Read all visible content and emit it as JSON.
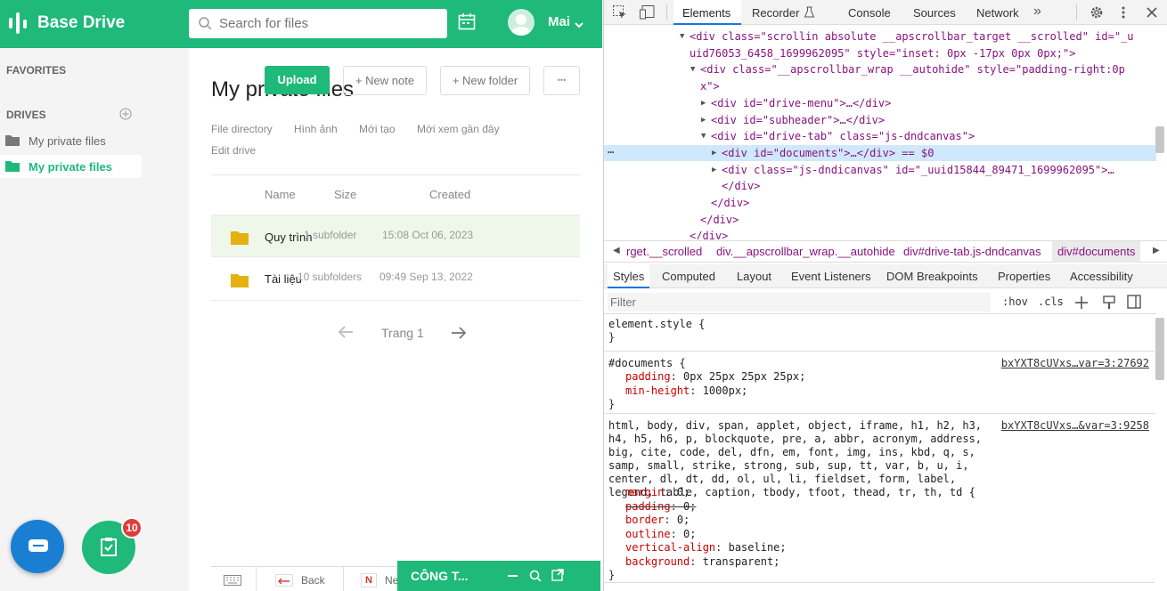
{
  "app": {
    "brand": "Base Drive",
    "search_placeholder": "Search for files",
    "user": "Mai",
    "sidebar": {
      "favorites": "FAVORITES",
      "drives": "DRIVES",
      "items": [
        {
          "label": "My private files"
        },
        {
          "label": "My private files"
        }
      ]
    },
    "main": {
      "title": "My private files",
      "upload": "Upload",
      "new_note": "+ New note",
      "new_folder": "+ New folder",
      "more": "•••",
      "tabs": [
        "File directory",
        "Hình ảnh",
        "Mới tạo",
        "Mới xem gần đây",
        "Edit drive"
      ],
      "columns": {
        "name": "Name",
        "size": "Size",
        "created": "Created"
      },
      "rows": [
        {
          "name": "Quy trình",
          "size": "1 subfolder",
          "created": "15:08 Oct 06, 2023"
        },
        {
          "name": "Tài liệu",
          "size": "10 subfolders",
          "created": "09:49 Sep 13, 2022"
        }
      ],
      "page": "Trang 1"
    },
    "badge": "10",
    "bottom": {
      "back": "Back",
      "next": "Ne",
      "company": "CÔNG T..."
    }
  },
  "devtools": {
    "tabs": [
      "Elements",
      "Recorder",
      "Console",
      "Sources",
      "Network"
    ],
    "tree": [
      {
        "indent": 0,
        "arrow": "▼",
        "html": "<div class=\"scrollin absolute __apscrollbar_target __scrolled\" id=\"_u"
      },
      {
        "indent": 0,
        "arrow": "",
        "html": "uid76053_6458_1699962095\" style=\"inset: 0px -17px 0px 0px;\">"
      },
      {
        "indent": 1,
        "arrow": "▼",
        "html": "<div class=\"__apscrollbar_wrap __autohide\" style=\"padding-right:0p"
      },
      {
        "indent": 1,
        "arrow": "",
        "html": "x\">"
      },
      {
        "indent": 2,
        "arrow": "▶",
        "html": "<div id=\"drive-menu\">…</div>"
      },
      {
        "indent": 2,
        "arrow": "▶",
        "html": "<div id=\"subheader\">…</div>"
      },
      {
        "indent": 2,
        "arrow": "▼",
        "html": "<div id=\"drive-tab\" class=\"js-dndcanvas\">"
      },
      {
        "indent": 3,
        "arrow": "▶",
        "html": "<div id=\"documents\">…</div> == $0"
      },
      {
        "indent": 3,
        "arrow": "▶",
        "html": "<div class=\"js-dndicanvas\" id=\"_uuid15844_89471_1699962095\">…"
      },
      {
        "indent": 3,
        "arrow": "",
        "html": "</div>"
      },
      {
        "indent": 2,
        "arrow": "",
        "html": "</div>"
      },
      {
        "indent": 1,
        "arrow": "",
        "html": "</div>"
      },
      {
        "indent": 0,
        "arrow": "",
        "html": "</div>"
      }
    ],
    "breadcrumbs": [
      "rget.__scrolled",
      "div.__apscrollbar_wrap.__autohide",
      "div#drive-tab.js-dndcanvas",
      "div#documents"
    ],
    "subtabs": [
      "Styles",
      "Computed",
      "Layout",
      "Event Listeners",
      "DOM Breakpoints",
      "Properties",
      "Accessibility"
    ],
    "filter": "Filter",
    "hov": ":hov",
    "cls": ".cls",
    "rules": [
      {
        "selector": "element.style {",
        "source": "",
        "props": []
      },
      {
        "selector": "#documents {",
        "source": "bxYXT8cUVxs…var=3:27692",
        "props": [
          {
            "name": "padding",
            "value": "0px 25px 25px 25px;"
          },
          {
            "name": "min-height",
            "value": "1000px;"
          }
        ]
      },
      {
        "selector": "html, body, div, span, applet, object, iframe, h1, h2, h3, h4, h5, h6, p, blockquote, pre, a, abbr, acronym, address, big, cite, code, del, dfn, em, font, img, ins, kbd, q, s, samp, small, strike, strong, sub, sup, tt, var, b, u, i, center, dl, dt, dd, ol, ul, li, fieldset, form, label, legend, table, caption, tbody, tfoot, thead, tr, th, td {",
        "source": "bxYXT8cUVxs…&var=3:9258",
        "props": [
          {
            "name": "margin",
            "value": "0;"
          },
          {
            "name": "padding",
            "value": "0;",
            "strike": true
          },
          {
            "name": "border",
            "value": "0;"
          },
          {
            "name": "outline",
            "value": "0;"
          },
          {
            "name": "vertical-align",
            "value": "baseline;"
          },
          {
            "name": "background",
            "value": "transparent;"
          }
        ]
      }
    ]
  },
  "colors": {
    "brand": "#1fb97a",
    "selected_row": "#eef7ea",
    "badge": "#e23b3b"
  }
}
